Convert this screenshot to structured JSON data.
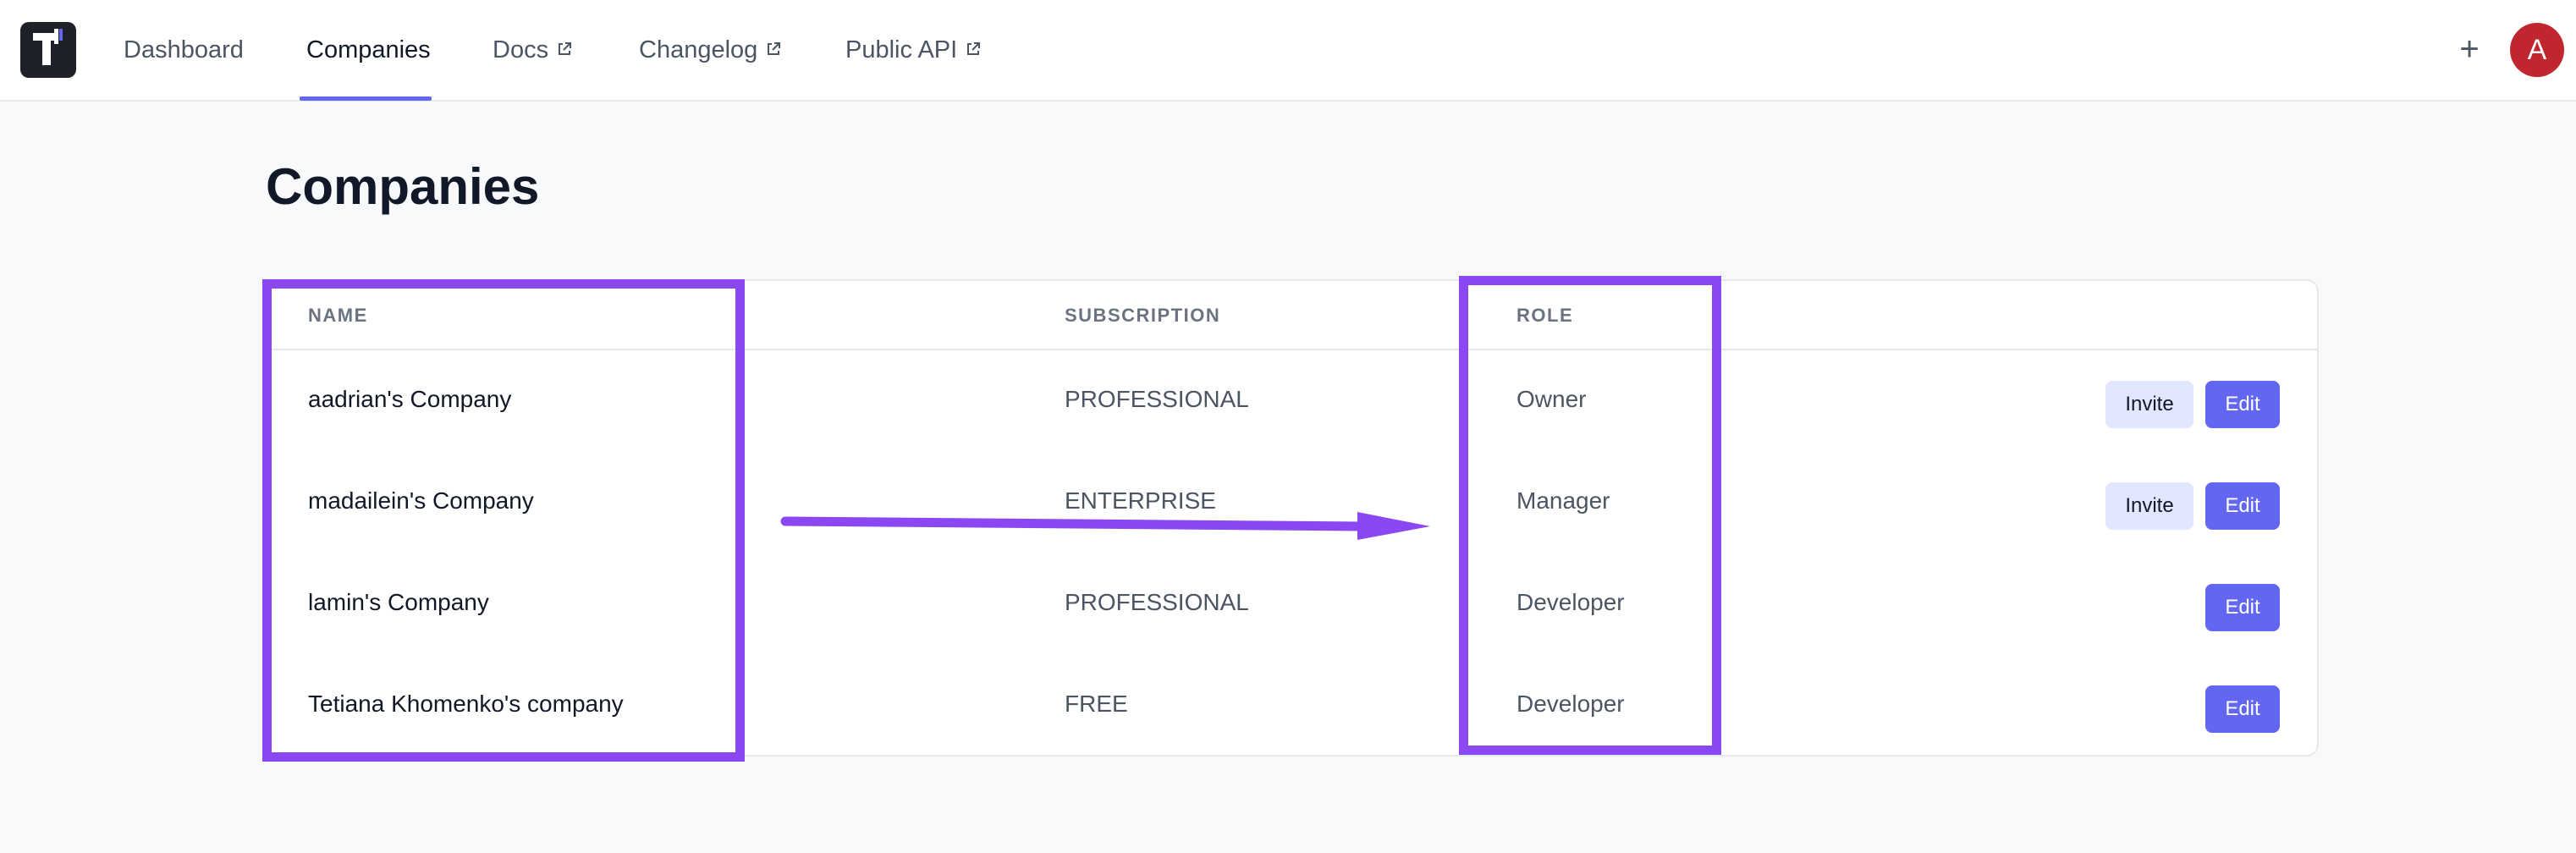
{
  "nav": {
    "logo_icon": "app-logo-icon",
    "items": [
      {
        "label": "Dashboard",
        "external": false
      },
      {
        "label": "Companies",
        "external": false,
        "active": true
      },
      {
        "label": "Docs",
        "external": true
      },
      {
        "label": "Changelog",
        "external": true
      },
      {
        "label": "Public API",
        "external": true
      }
    ],
    "plus": "+",
    "avatar_initial": "A"
  },
  "page": {
    "title": "Companies"
  },
  "table": {
    "columns": {
      "name": "NAME",
      "subscription": "SUBSCRIPTION",
      "role": "ROLE"
    },
    "rows": [
      {
        "name": "aadrian's Company",
        "subscription": "PROFESSIONAL",
        "role": "Owner",
        "invite_label": "Invite",
        "edit_label": "Edit"
      },
      {
        "name": "madailein's Company",
        "subscription": "ENTERPRISE",
        "role": "Manager",
        "invite_label": "Invite",
        "edit_label": "Edit"
      },
      {
        "name": "lamin's Company",
        "subscription": "PROFESSIONAL",
        "role": "Developer",
        "edit_label": "Edit"
      },
      {
        "name": "Tetiana Khomenko's company",
        "subscription": "FREE",
        "role": "Developer",
        "edit_label": "Edit"
      }
    ]
  },
  "colors": {
    "accent": "#6366f1",
    "annotation": "#8b48f2",
    "avatar": "#c0262d",
    "invite_bg": "#e0e7ff"
  }
}
